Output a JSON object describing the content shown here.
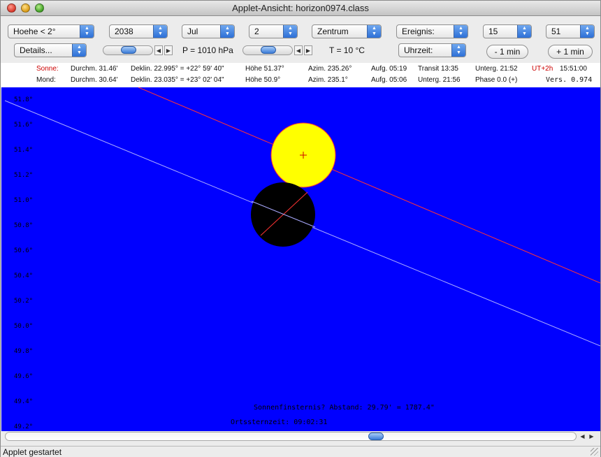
{
  "window": {
    "title": "Applet-Ansicht: horizon0974.class"
  },
  "toolbar": {
    "row1": {
      "height_select": "Hoehe < 2°",
      "year_select": "2038",
      "month_select": "Jul",
      "day_select": "2",
      "view_select": "Zentrum",
      "event_select": "Ereignis:",
      "hour_select": "15",
      "minute_select": "51"
    },
    "row2": {
      "details_select": "Details...",
      "pressure_label": "P = 1010 hPa",
      "temperature_label": "T = 10 °C",
      "time_select": "Uhrzeit:",
      "minus_button": "- 1 min",
      "plus_button": "+ 1 min"
    }
  },
  "info": {
    "sun": {
      "name": "Sonne:",
      "diameter": "Durchm. 31.46'",
      "declination": "Deklin. 22.995° = +22° 59' 40\"",
      "altitude": "Höhe 51.37°",
      "azimuth": "Azim. 235.26°",
      "rise": "Aufg. 05:19",
      "transit": "Transit 13:35",
      "set": "Unterg. 21:52",
      "utc_offset": "UT+2h",
      "time": "15:51:00"
    },
    "moon": {
      "name": "Mond:",
      "diameter": "Durchm. 30.64'",
      "declination": "Deklin. 23.035° = +23° 02' 04\"",
      "altitude": "Höhe 50.9°",
      "azimuth": "Azim. 235.1°",
      "rise": "Aufg. 05:06",
      "set": "Unterg. 21:56",
      "phase": "Phase 0.0 (+)",
      "version": "Vers. 0.974"
    }
  },
  "sky": {
    "altitude_ticks": [
      "51.8°",
      "51.6°",
      "51.4°",
      "51.2°",
      "51.0°",
      "50.8°",
      "50.6°",
      "50.4°",
      "50.2°",
      "50.0°",
      "49.8°",
      "49.6°",
      "49.4°",
      "49.2°"
    ],
    "eclipse_text": "Sonnenfinsternis? Abstand: 29.79' = 1787.4\"",
    "sidereal_time": "Ortssternzeit: 09:02:31",
    "colors": {
      "background": "#0000ff",
      "sun": "#ffff00",
      "moon": "#000000",
      "sun_path": "#ff3333",
      "moon_path": "#aaaaff"
    }
  },
  "status": {
    "text": "Applet gestartet"
  }
}
